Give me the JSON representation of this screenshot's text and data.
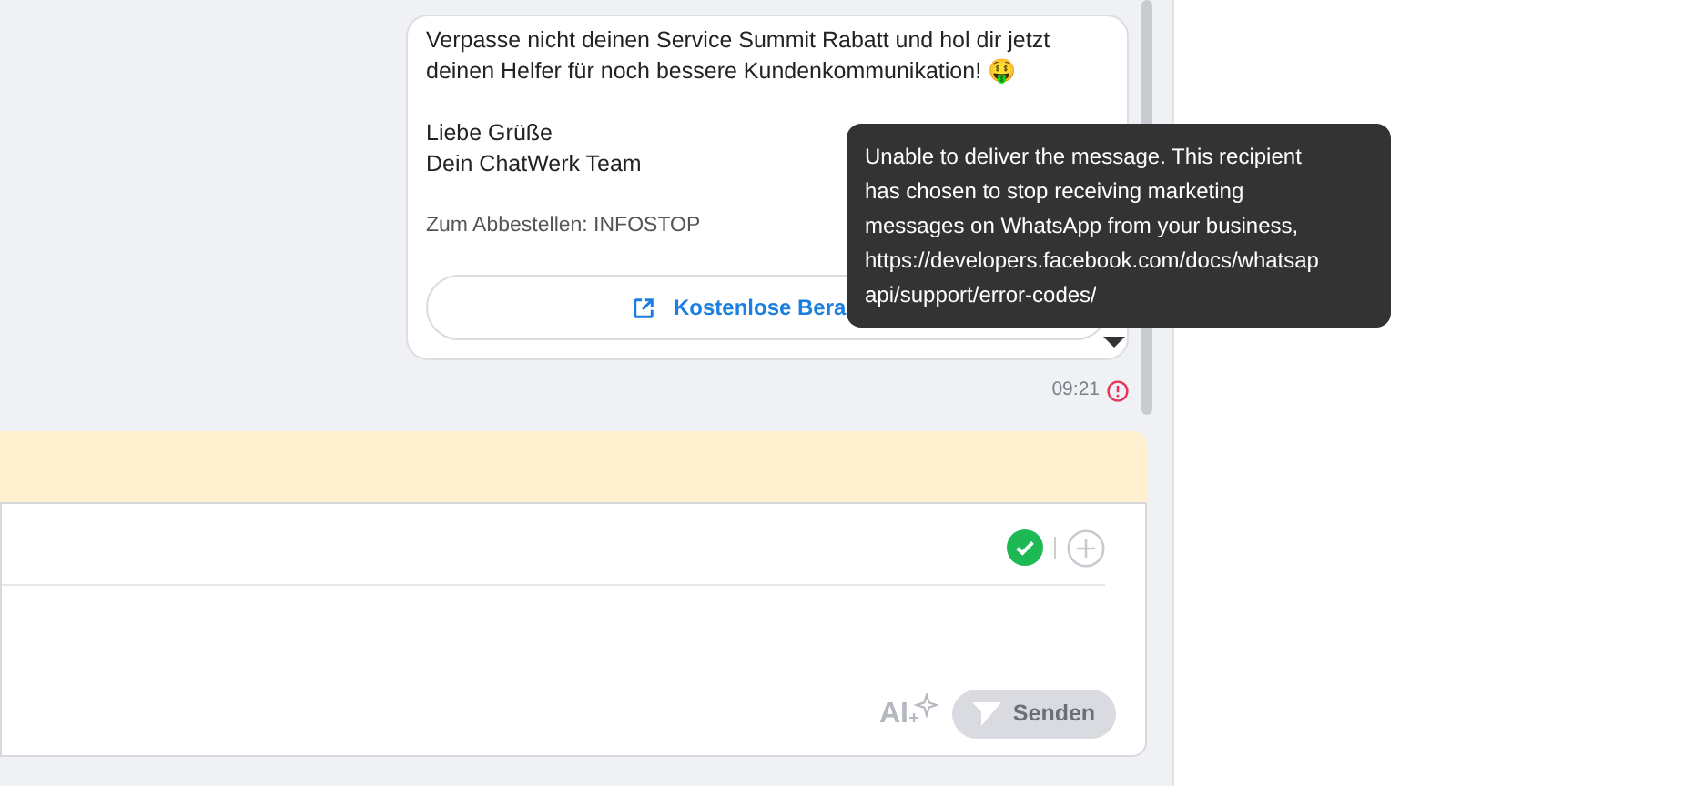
{
  "message": {
    "paragraphs": [
      "Verpasse nicht deinen Service Summit Rabatt und hol dir jetzt deinen Helfer für noch bessere Kundenkommunikation! 🤑",
      "Liebe Grüße\nDein ChatWerk Team"
    ],
    "footer": "Zum Abbestellen: INFOSTOP",
    "button": {
      "label": "Kostenlose Bera"
    },
    "time": "09:21",
    "failed": true
  },
  "tooltip": {
    "lines": [
      "Unable to deliver the message. This recipient",
      "has chosen to stop receiving marketing",
      "messages on WhatsApp from your business,",
      "https://developers.facebook.com/docs/whatsap",
      "api/support/error-codes/"
    ]
  },
  "composer": {
    "valid": true,
    "ai_label": "AI",
    "send": {
      "label": "Senden",
      "disabled": true
    }
  }
}
